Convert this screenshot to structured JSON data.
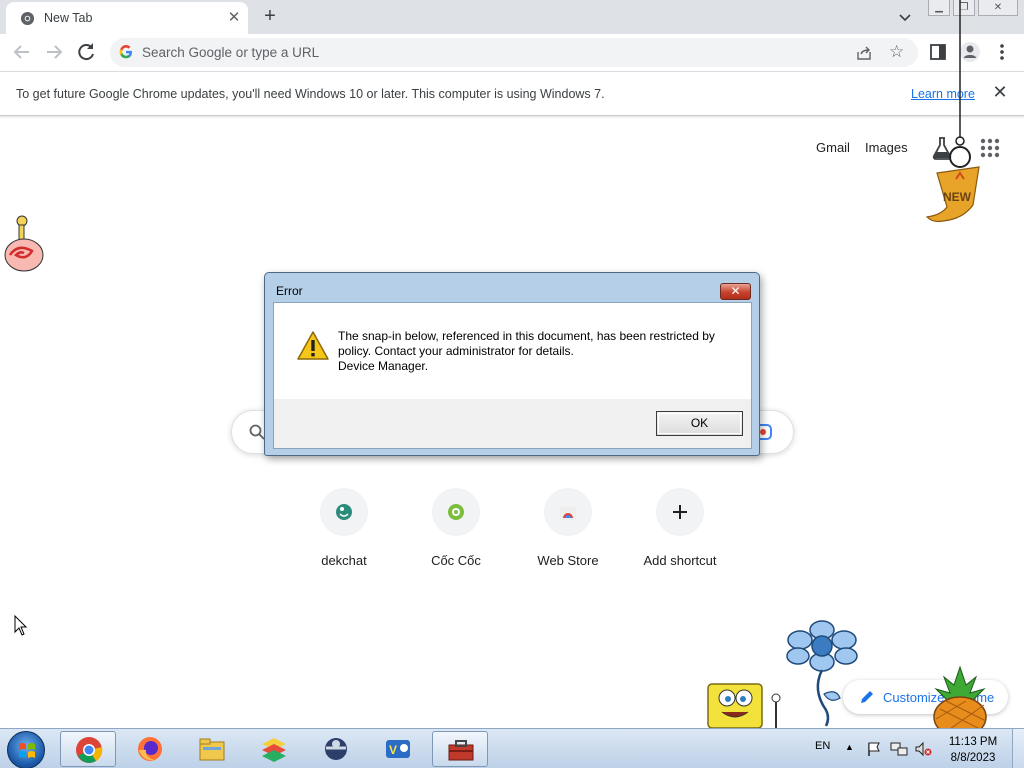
{
  "browser": {
    "tab": {
      "title": "New Tab"
    },
    "omnibox": {
      "placeholder": "Search Google or type a URL"
    }
  },
  "infobar": {
    "message": "To get future Google Chrome updates, you'll need Windows 10 or later. This computer is using Windows 7.",
    "link": "Learn more"
  },
  "ntp": {
    "links": {
      "gmail": "Gmail",
      "images": "Images"
    },
    "shortcuts": [
      {
        "label": "dekchat",
        "icon": "dekchat-icon"
      },
      {
        "label": "Cốc Cốc",
        "icon": "coccoc-icon"
      },
      {
        "label": "Web Store",
        "icon": "webstore-icon"
      },
      {
        "label": "Add shortcut",
        "icon": "plus-icon"
      }
    ],
    "customize": "Customize Chrome",
    "new_badge": "NEW"
  },
  "dialog": {
    "title": "Error",
    "line1": "The snap-in below, referenced in this document, has been restricted by",
    "line2": "policy. Contact your administrator for details.",
    "line3": "Device Manager.",
    "ok": "OK"
  },
  "taskbar": {
    "apps": [
      "chrome-icon",
      "firefox-icon",
      "file-explorer-icon",
      "bluestacks-icon",
      "network-icon",
      "unikey-icon",
      "toolbox-icon"
    ],
    "language": "EN",
    "time": "11:13 PM",
    "date": "8/8/2023"
  },
  "colors": {
    "accent": "#1a73e8",
    "tabstrip": "#dee1e6",
    "dialog_frame": "#b6cfe8"
  }
}
